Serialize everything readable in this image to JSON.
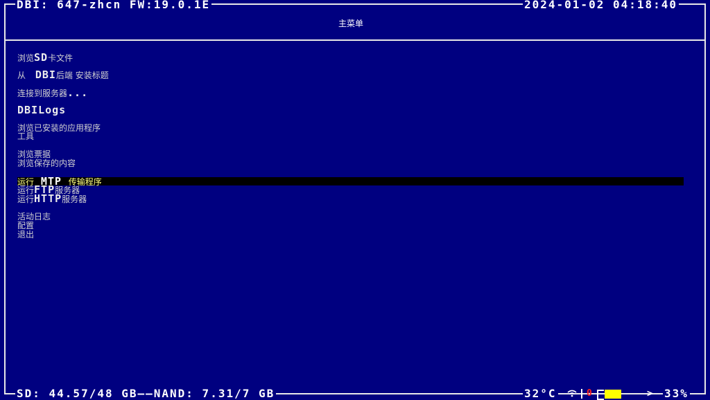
{
  "header": {
    "app_info": "DBI: 647-zhcn FW:19.0.1E",
    "datetime": "2024-01-02 04:18:40"
  },
  "menu_title": "主菜单",
  "menu": {
    "browse_sd": {
      "pre": "浏览",
      "bold": "SD",
      "post": "卡文件"
    },
    "dbi_backend": {
      "pre": "从 ",
      "bold": "DBI",
      "post": "后端  安装标题"
    },
    "connect_server": {
      "pre": "连接到服务器",
      "bold": "...",
      "post": ""
    },
    "dbi_logs": {
      "pre": "",
      "bold": "DBILogs",
      "post": ""
    },
    "browse_apps": "浏览已安装的应用程序",
    "tools": "工具",
    "browse_tickets": "浏览票据",
    "browse_saves": "浏览保存的内容",
    "run_mtp": {
      "pre": "运行 ",
      "bold": "MTP",
      "post": " 传输程序"
    },
    "run_ftp": {
      "pre": "运行",
      "bold": "FTP",
      "post": "服务器"
    },
    "run_http": {
      "pre": "运行",
      "bold": "HTTP",
      "post": "服务器"
    },
    "activity_log": "活动日志",
    "config": "配置",
    "exit": "退出"
  },
  "footer": {
    "storage": "SD: 44.57/48 GB——NAND: 7.31/7 GB",
    "temperature": "32°C",
    "battery_state": "0",
    "battery_percent": "33%",
    "battery_level": 0.33
  },
  "colors": {
    "background": "#000080",
    "selection_bar": "#000000",
    "selected_text": "#ffff80",
    "battery_fill": "#ffff00",
    "battery_warning": "#ff2020"
  },
  "icons": {
    "wifi": "wifi-icon",
    "battery": "battery-icon",
    "charge": "chevron-right-icon"
  }
}
